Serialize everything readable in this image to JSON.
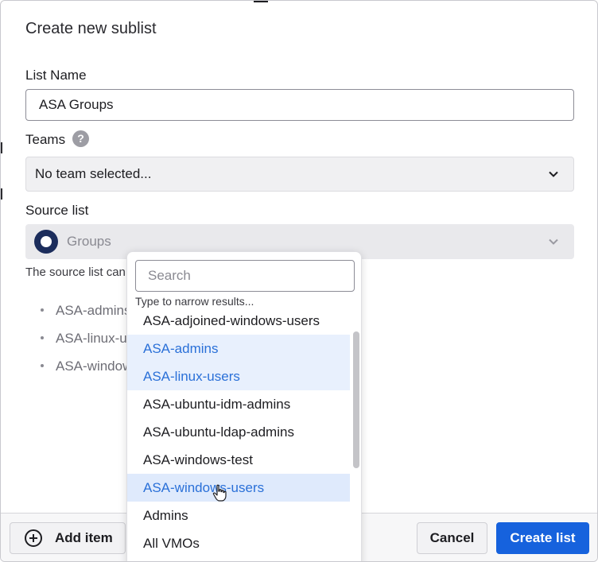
{
  "dialog": {
    "title": "Create new sublist",
    "list_name": {
      "label": "List Name",
      "value": "ASA Groups"
    },
    "teams": {
      "label": "Teams",
      "help_icon": "question-circle-icon",
      "value": "No team selected..."
    },
    "source_list": {
      "label": "Source list",
      "value": "Groups",
      "helper_text": "The source list can",
      "items": [
        "ASA-admins",
        "ASA-linux-users",
        "ASA-windows-users"
      ]
    }
  },
  "dropdown": {
    "search_placeholder": "Search",
    "hint": "Type to narrow results...",
    "options": [
      {
        "label": "ASA-adjoined-windows-users",
        "state": "normal"
      },
      {
        "label": "ASA-admins",
        "state": "selected"
      },
      {
        "label": "ASA-linux-users",
        "state": "selected"
      },
      {
        "label": "ASA-ubuntu-idm-admins",
        "state": "normal"
      },
      {
        "label": "ASA-ubuntu-ldap-admins",
        "state": "normal"
      },
      {
        "label": "ASA-windows-test",
        "state": "normal"
      },
      {
        "label": "ASA-windows-users",
        "state": "hovered"
      },
      {
        "label": "Admins",
        "state": "normal"
      },
      {
        "label": "All VMOs",
        "state": "normal"
      }
    ]
  },
  "footer": {
    "add_item_label": "Add item",
    "cancel_label": "Cancel",
    "create_label": "Create list"
  },
  "colors": {
    "primary": "#1662dd",
    "selected_text": "#2a70d8",
    "selected_bg": "#e8f0fd",
    "group_logo": "#1c2d5c"
  }
}
